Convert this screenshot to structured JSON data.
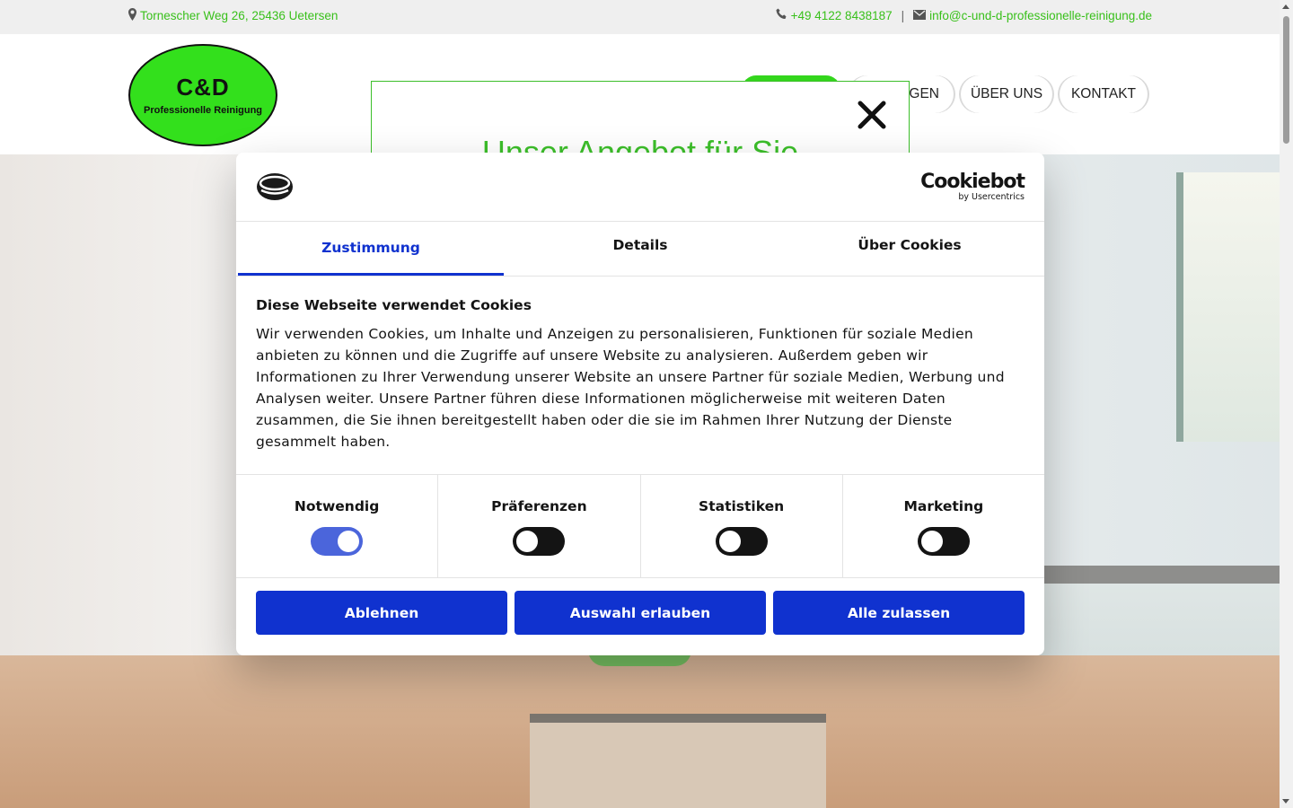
{
  "topbar": {
    "address": "Tornescher Weg 26, 25436 Uetersen",
    "phone": "+49 4122 8438187",
    "separator": "|",
    "email": "info@c-und-d-professionelle-reinigung.de",
    "icons": [
      "map-marker-icon",
      "phone-icon",
      "envelope-icon"
    ]
  },
  "logo": {
    "title": "C&D",
    "subtitle": "Professionelle Reinigung"
  },
  "nav": {
    "items": [
      {
        "label": "NGEN"
      },
      {
        "label": "ÜBER UNS"
      },
      {
        "label": "KONTAKT"
      }
    ]
  },
  "offer_popup": {
    "title": "Unser Angebot für Sie"
  },
  "cookie_dialog": {
    "brand_name": "Cookiebot",
    "brand_sub": "by Usercentrics",
    "tabs": [
      {
        "label": "Zustimmung",
        "active": true
      },
      {
        "label": "Details",
        "active": false
      },
      {
        "label": "Über Cookies",
        "active": false
      }
    ],
    "heading": "Diese Webseite verwendet Cookies",
    "text": "Wir verwenden Cookies, um Inhalte und Anzeigen zu personalisieren, Funktionen für soziale Medien anbieten zu können und die Zugriffe auf unsere Website zu analysieren. Außerdem geben wir Informationen zu Ihrer Verwendung unserer Website an unsere Partner für soziale Medien, Werbung und Analysen weiter. Unsere Partner führen diese Informationen möglicherweise mit weiteren Daten zusammen, die Sie ihnen bereitgestellt haben oder die sie im Rahmen Ihrer Nutzung der Dienste gesammelt haben.",
    "toggles": [
      {
        "label": "Notwendig",
        "on": true
      },
      {
        "label": "Präferenzen",
        "on": false
      },
      {
        "label": "Statistiken",
        "on": false
      },
      {
        "label": "Marketing",
        "on": false
      }
    ],
    "buttons": {
      "decline": "Ablehnen",
      "allow_selection": "Auswahl erlauben",
      "allow_all": "Alle zulassen"
    }
  },
  "colors": {
    "accent_green": "#39c01b",
    "cookie_blue": "#1032cf"
  }
}
